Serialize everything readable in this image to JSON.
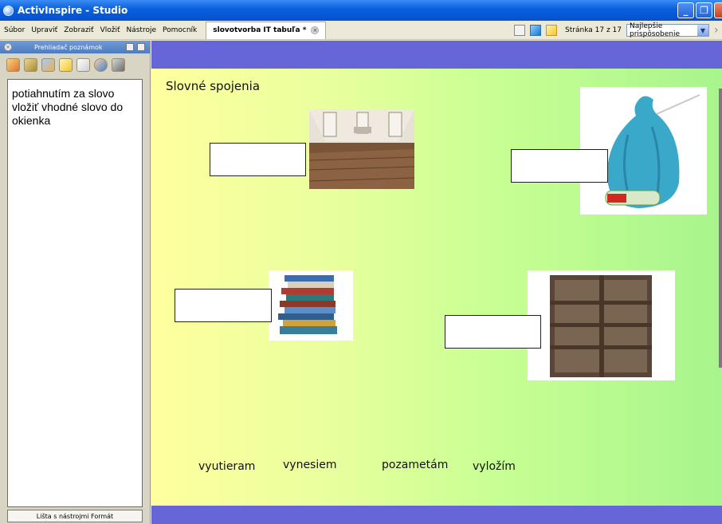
{
  "window": {
    "title": "ActivInspire - Studio"
  },
  "menu": {
    "items": [
      "Súbor",
      "Upraviť",
      "Zobraziť",
      "Vložiť",
      "Nástroje",
      "Pomocník"
    ],
    "document_tab": "slovotvorba IT tabuľa *",
    "page_status": "Stránka 17 z 17",
    "zoom_value": "Najlepšie prispôsobenie"
  },
  "left_panel": {
    "title": "Prehliadač poznámok",
    "notes_text": "potiahnutím  za slovo vložiť  vhodné slovo do okienka",
    "footer_label": "Lišta s nástrojmi Formát"
  },
  "canvas": {
    "title": "Slovné spojenia",
    "words": [
      "vyutieram",
      "vynesiem",
      "pozametám",
      "vyložím"
    ],
    "colors": {
      "band": "#6666d8",
      "gradient_left": "#ffff9e",
      "gradient_right": "#a7f58c"
    },
    "images": [
      "floor-room-image",
      "trash-bag-image",
      "book-stack-image",
      "shelf-image"
    ]
  },
  "icons": [
    "app-icon",
    "minimize-icon",
    "restore-icon",
    "close-icon",
    "page-view-icon",
    "blue-tool-icon",
    "note-icon"
  ]
}
